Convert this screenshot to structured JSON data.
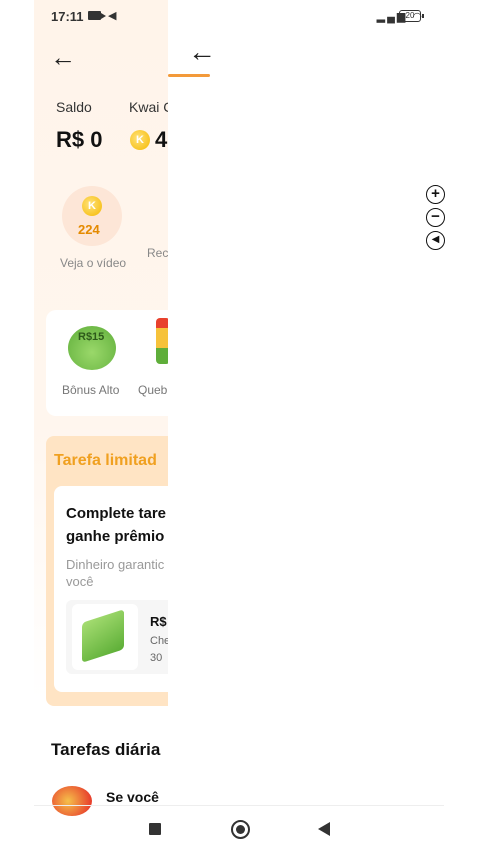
{
  "status_bar": {
    "time": "17:11",
    "battery": "20"
  },
  "app": {
    "saldo_label": "Saldo",
    "saldo_value": "R$ 0",
    "kwai_label": "Kwai C",
    "kwai_value": "4",
    "coin_glyph": "K",
    "video": {
      "coins": "224",
      "label": "Veja o vídeo"
    },
    "rec_label": "Rec",
    "bonus": {
      "tag": "R$15",
      "label": "Bônus Alto"
    },
    "break_label": "Queb",
    "task": {
      "title": "Tarefa limitad",
      "heading_line1": "Complete tare",
      "heading_line2": "ganhe prêmio",
      "sub_line1": "Dinheiro garantic",
      "sub_line2": "você",
      "reward_value": "R$",
      "reward_line1": "Che",
      "reward_line2": "30"
    },
    "daily_title": "Tarefas diária",
    "daily_item": "Se você"
  },
  "webview": {
    "zoom_in": "+",
    "zoom_out": "−",
    "sound": "◀"
  },
  "colors": {
    "accent": "#f39a3a",
    "task_title": "#f0a020",
    "coin": "#f5b800"
  },
  "icons": [
    "back-arrow-icon",
    "camera-icon",
    "speaker-icon",
    "signal-icon",
    "wifi-icon",
    "battery-icon",
    "zoom-in-icon",
    "zoom-out-icon",
    "sound-icon",
    "nav-recents-icon",
    "nav-home-icon",
    "nav-back-icon"
  ]
}
